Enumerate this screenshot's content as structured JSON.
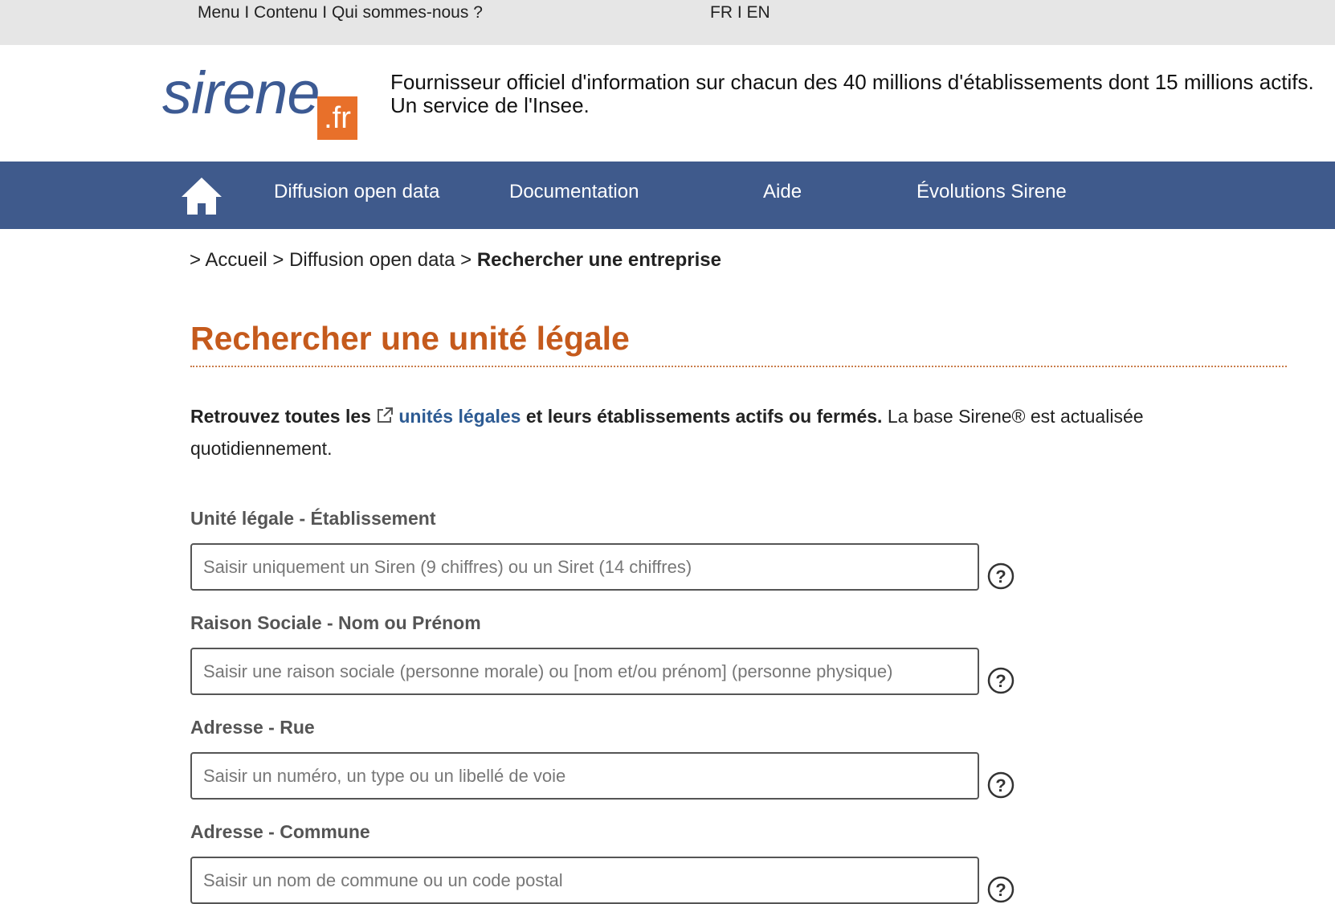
{
  "topbar": {
    "skip_links": {
      "menu": "Menu",
      "sep1": " I ",
      "content": "Contenu",
      "sep2": " I ",
      "about": "Qui sommes-nous ?"
    },
    "lang": {
      "fr": "FR",
      "sep": " I ",
      "en": "EN"
    }
  },
  "header": {
    "logo": {
      "word": "sirene",
      "suffix": ".fr"
    },
    "tagline_line1": "Fournisseur officiel d'information sur chacun des 40 millions d'établissements dont 15 millions actifs.",
    "tagline_line2": "Un service de l'Insee."
  },
  "nav": {
    "home_icon": "home-icon",
    "items": [
      "Diffusion open data",
      "Documentation",
      "Aide",
      "Évolutions Sirene"
    ]
  },
  "breadcrumb": {
    "sep": "> ",
    "items": [
      "Accueil",
      "Diffusion open data"
    ],
    "current": "Rechercher une entreprise"
  },
  "page": {
    "title": "Rechercher une unité légale",
    "intro_bold_start": "Retrouvez toutes les ",
    "intro_link": "unités légales",
    "intro_bold_end": " et leurs établissements actifs ou fermés.",
    "intro_rest": " La base Sirene® est actualisée quotidiennement."
  },
  "form": {
    "fields": [
      {
        "label": "Unité légale - Établissement",
        "placeholder": "Saisir uniquement un Siren (9 chiffres) ou un Siret (14 chiffres)",
        "value": ""
      },
      {
        "label": "Raison Sociale - Nom ou Prénom",
        "placeholder": "Saisir une raison sociale (personne morale) ou [nom et/ou prénom] (personne physique)",
        "value": ""
      },
      {
        "label": "Adresse - Rue",
        "placeholder": "Saisir un numéro, un type ou un libellé de voie",
        "value": ""
      },
      {
        "label": "Adresse - Commune",
        "placeholder": "Saisir un nom de commune ou un code postal",
        "value": ""
      }
    ],
    "help_icon": "question-circle-icon"
  },
  "colors": {
    "nav_bg": "#3f5a8c",
    "title": "#c55a1c",
    "link": "#2d5b93",
    "logo_blue": "#3c5a93",
    "logo_orange": "#e8702a"
  }
}
